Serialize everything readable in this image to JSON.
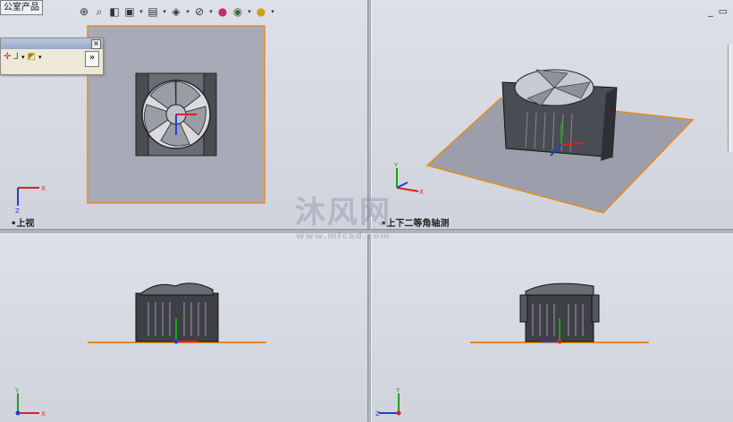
{
  "document_tab": "公室产品",
  "toolbar": {
    "icons": [
      "zoom-to-fit-icon",
      "zoom-area-icon",
      "previous-view-icon",
      "section-view-icon",
      "view-orientation-icon",
      "display-style-icon",
      "hide-show-icon",
      "edit-appearance-icon",
      "apply-scene-icon",
      "view-settings-icon"
    ]
  },
  "floating_toolbar": {
    "close": "×",
    "expand": "»"
  },
  "window_controls": {
    "minimize": "_",
    "restore": "▭"
  },
  "viewports": {
    "top_left": {
      "label": "•上视"
    },
    "top_right": {
      "label": "•上下二等角轴测"
    },
    "bottom_left": {
      "label": ""
    },
    "bottom_right": {
      "label": ""
    }
  },
  "axes": {
    "x": "X",
    "y": "Y",
    "z": "Z"
  },
  "watermark": {
    "text": "沐风网",
    "sub": "www.mfcad.com"
  },
  "colors": {
    "plane_fill": "#a8aab8",
    "plane_edge": "#e88a1a",
    "x_axis": "#e02020",
    "y_axis": "#20a020",
    "z_axis": "#2040d0"
  }
}
